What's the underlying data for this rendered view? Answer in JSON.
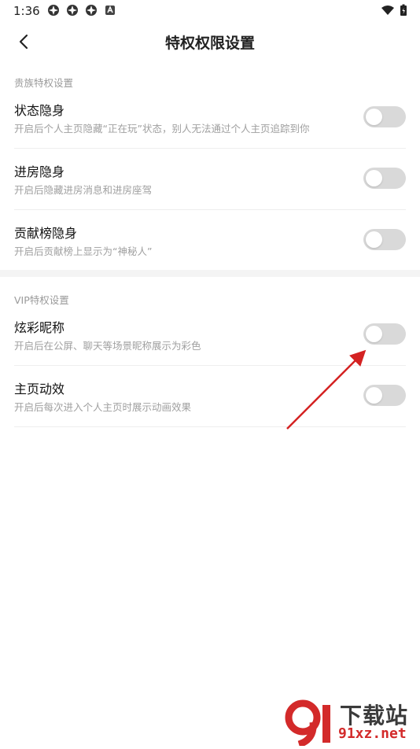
{
  "status_bar": {
    "time": "1:36",
    "icons": [
      "app-icon",
      "app-icon",
      "app-icon",
      "notification-icon"
    ],
    "right_icons": [
      "wifi-icon",
      "battery-icon"
    ]
  },
  "header": {
    "title": "特权权限设置",
    "back_icon": "chevron-left-icon"
  },
  "sections": [
    {
      "label": "贵族特权设置",
      "items": [
        {
          "title": "状态隐身",
          "desc": "开启后个人主页隐藏“正在玩”状态，别人无法通过个人主页追踪到你",
          "enabled": false
        },
        {
          "title": "进房隐身",
          "desc": "开启后隐藏进房消息和进房座驾",
          "enabled": false
        },
        {
          "title": "贡献榜隐身",
          "desc": "开启后贡献榜上显示为“神秘人”",
          "enabled": false
        }
      ]
    },
    {
      "label": "VIP特权设置",
      "items": [
        {
          "title": "炫彩昵称",
          "desc": "开启后在公屏、聊天等场景昵称展示为彩色",
          "enabled": false
        },
        {
          "title": "主页动效",
          "desc": "开启后每次进入个人主页时展示动画效果",
          "enabled": false
        }
      ]
    }
  ],
  "watermark": {
    "text": "下载站",
    "url": "91xz.net"
  },
  "colors": {
    "toggle_off": "#d9d9d9",
    "arrow": "#d42222",
    "watermark_red": "#d32a2a"
  }
}
